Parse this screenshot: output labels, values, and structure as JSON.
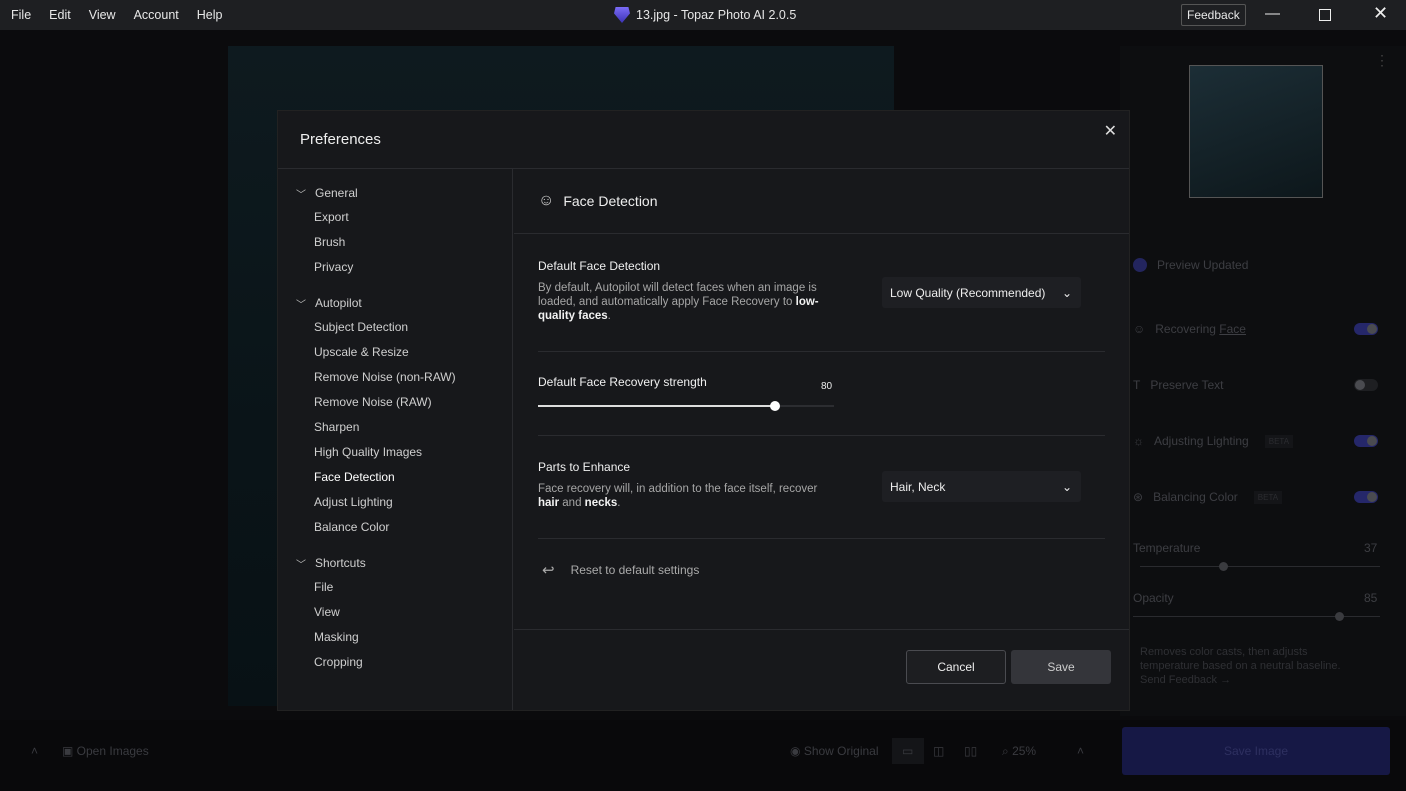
{
  "menu": [
    "File",
    "Edit",
    "View",
    "Account",
    "Help"
  ],
  "window_title": "13.jpg - Topaz Photo AI 2.0.5",
  "feedback": "Feedback",
  "right_panel": {
    "preview_status": "Preview Updated",
    "rows": [
      {
        "label": "Recovering ",
        "link": "Face",
        "on": true,
        "badge": ""
      },
      {
        "label": "Preserve Text",
        "link": "",
        "on": false,
        "badge": ""
      },
      {
        "label": "Adjusting Lighting",
        "link": "",
        "on": true,
        "badge": "BETA"
      },
      {
        "label": "Balancing Color",
        "link": "",
        "on": true,
        "badge": "BETA"
      }
    ],
    "temperature": {
      "label": "Temperature",
      "value": "37"
    },
    "opacity": {
      "label": "Opacity",
      "value": "85"
    },
    "description": "Removes color casts, then adjusts temperature based on a neutral baseline.",
    "send_feedback": "Send Feedback →"
  },
  "bottom": {
    "open_images": "Open Images",
    "show_original": "Show Original",
    "zoom": "25%",
    "save_image": "Save Image"
  },
  "prefs": {
    "title": "Preferences",
    "groups": [
      {
        "label": "General",
        "items": [
          "Export",
          "Brush",
          "Privacy"
        ]
      },
      {
        "label": "Autopilot",
        "items": [
          "Subject Detection",
          "Upscale & Resize",
          "Remove Noise (non-RAW)",
          "Remove Noise (RAW)",
          "Sharpen",
          "High Quality Images",
          "Face Detection",
          "Adjust Lighting",
          "Balance Color"
        ]
      },
      {
        "label": "Shortcuts",
        "items": [
          "File",
          "View",
          "Masking",
          "Cropping"
        ]
      }
    ],
    "active_item": "Face Detection",
    "section_title": "Face Detection",
    "default_detection": {
      "title": "Default Face Detection",
      "desc_pre": "By default, Autopilot will detect faces when an image is loaded, and automatically apply Face Recovery to ",
      "desc_bold": "low-quality faces",
      "desc_post": ".",
      "value": "Low Quality (Recommended)"
    },
    "strength": {
      "title": "Default Face Recovery strength",
      "value": "80",
      "max": 100
    },
    "parts": {
      "title": "Parts to Enhance",
      "desc_pre": "Face recovery will, in addition to the face itself, recover ",
      "bold1": "hair",
      "mid": " and ",
      "bold2": "necks",
      "post": ".",
      "value": "Hair, Neck"
    },
    "reset": "Reset to default settings",
    "cancel": "Cancel",
    "save": "Save"
  }
}
